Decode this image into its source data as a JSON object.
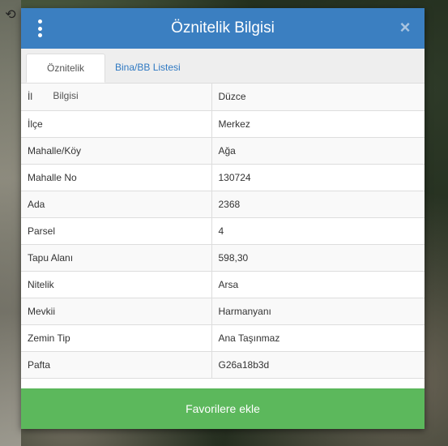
{
  "modal": {
    "title": "Öznitelik Bilgisi",
    "menu_icon": "vertical-dots-icon",
    "close_icon": "close-icon",
    "close_symbol": "×"
  },
  "tabs": [
    {
      "label": "Öznitelik Bilgisi",
      "active": true
    },
    {
      "label": "Bina/BB Listesi",
      "active": false
    }
  ],
  "attributes": [
    {
      "key": "İl",
      "value": "Düzce"
    },
    {
      "key": "İlçe",
      "value": "Merkez"
    },
    {
      "key": "Mahalle/Köy",
      "value": "Ağa"
    },
    {
      "key": "Mahalle No",
      "value": "130724"
    },
    {
      "key": "Ada",
      "value": "2368"
    },
    {
      "key": "Parsel",
      "value": "4"
    },
    {
      "key": "Tapu Alanı",
      "value": "598,30"
    },
    {
      "key": "Nitelik",
      "value": "Arsa"
    },
    {
      "key": "Mevkii",
      "value": "Harmanyanı"
    },
    {
      "key": "Zemin Tip",
      "value": "Ana Taşınmaz"
    },
    {
      "key": "Pafta",
      "value": "G26a18b3d"
    }
  ],
  "footer": {
    "favorite_label": "Favorilere ekle"
  },
  "map": {
    "tool_icon": "rotate-icon",
    "tool_symbol": "⟲"
  },
  "colors": {
    "header": "#3b7fc1",
    "button": "#5cb85c",
    "tab_link": "#2f79c2"
  }
}
